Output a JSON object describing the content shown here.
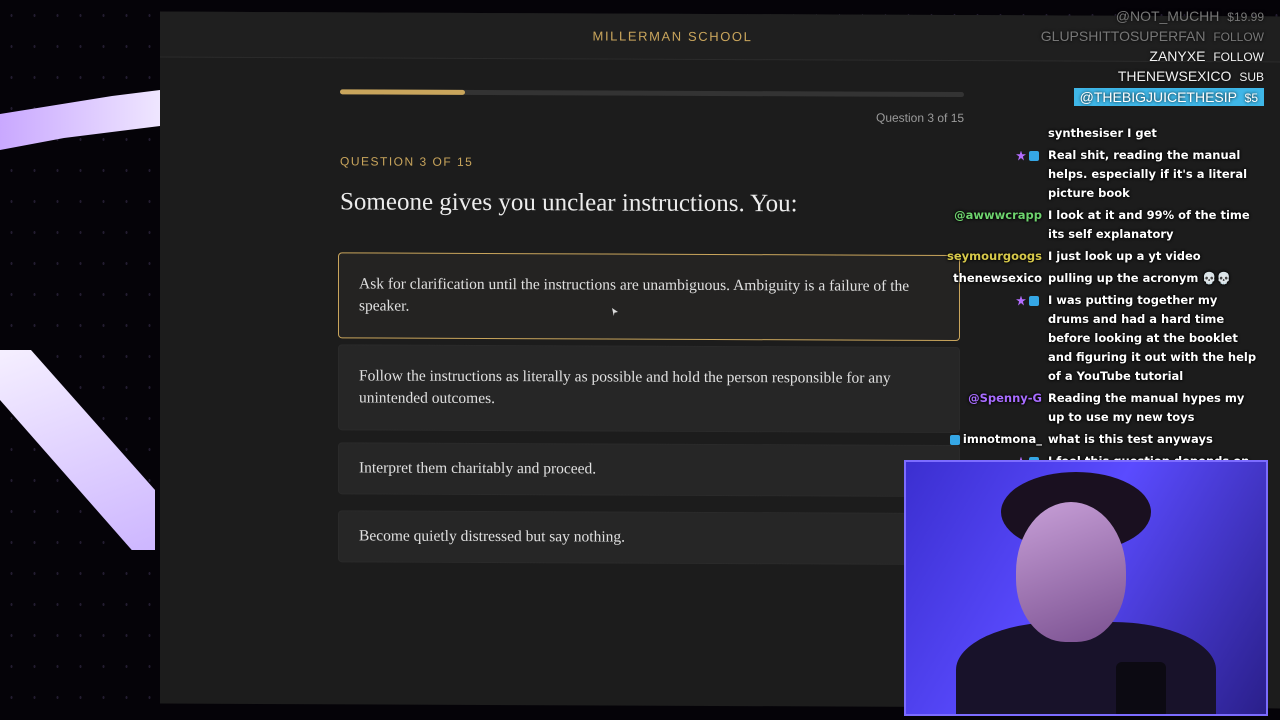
{
  "quiz": {
    "brand": "MILLERMAN SCHOOL",
    "progress_fraction": 0.2,
    "counter": "Question 3 of 15",
    "label": "QUESTION 3 OF 15",
    "question": "Someone gives you unclear instructions. You:",
    "options": [
      {
        "text": "Ask for clarification until the instructions are unambiguous. Ambiguity is a failure of the speaker."
      },
      {
        "text": "Follow the instructions as literally as possible and hold the person responsible for any unintended outcomes."
      },
      {
        "text": "Interpret them charitably and proceed."
      },
      {
        "text": "Become quietly distressed but say nothing."
      }
    ],
    "accent_color": "#c9a55c"
  },
  "alerts": [
    {
      "name": "@NOT_MUCHH",
      "action": "$19.99"
    },
    {
      "name": "GLUPSHITTOSUPERFAN",
      "action": "FOLLOW"
    },
    {
      "name": "ZANYXE",
      "action": "FOLLOW"
    },
    {
      "name": "THENEWSEXICO",
      "action": "SUB"
    },
    {
      "name": "@THEBIGJUICETHESIP",
      "action": "$5"
    }
  ],
  "chat": [
    {
      "user": "",
      "text": "synthesiser I get"
    },
    {
      "user": "",
      "text": "Real shit, reading the manual helps. especially if it's a literal picture book"
    },
    {
      "user": "@awwwcrapp",
      "text": "I look at it and 99% of the time its self explanatory"
    },
    {
      "user": "seymourgoogs",
      "text": "I just look up a yt video"
    },
    {
      "user": "thenewsexico",
      "text": "pulling up the acronym 💀💀"
    },
    {
      "user": "",
      "text": "I was putting together my drums and had a hard time before looking at the booklet and figuring it out with the help of a YouTube tutorial"
    },
    {
      "user": "@Spenny-G",
      "text": "Reading the manual hypes my up to use my new toys"
    },
    {
      "user": "imnotmona_",
      "text": "what is this test anyways"
    },
    {
      "user": "",
      "text": "I feel this question depends on the person"
    }
  ]
}
